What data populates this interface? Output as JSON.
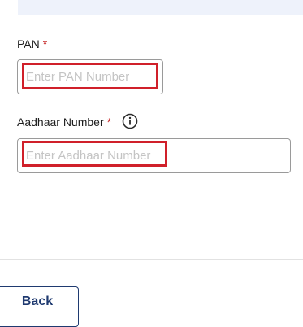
{
  "form": {
    "pan": {
      "label": "PAN",
      "required_mark": "*",
      "placeholder": "Enter PAN Number",
      "value": ""
    },
    "aadhaar": {
      "label": "Aadhaar Number",
      "required_mark": "*",
      "placeholder": "Enter Aadhaar Number",
      "value": "",
      "icon": "info-icon"
    }
  },
  "footer": {
    "back_label": "Back"
  },
  "colors": {
    "required": "#c62828",
    "highlight": "#d0202a",
    "button_text": "#1f3a70",
    "banner": "#eef2fb"
  }
}
